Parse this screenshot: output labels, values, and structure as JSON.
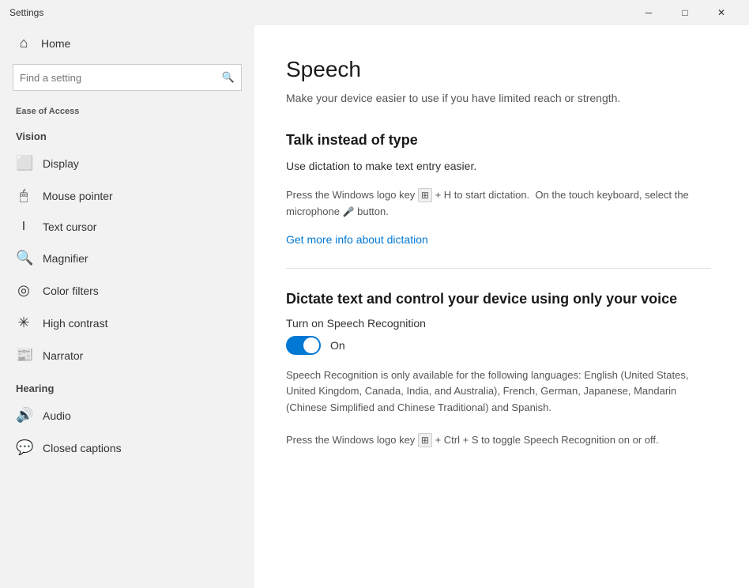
{
  "titleBar": {
    "title": "Settings",
    "minimizeLabel": "─",
    "maximizeLabel": "□",
    "closeLabel": "✕"
  },
  "sidebar": {
    "homeLabel": "Home",
    "searchPlaceholder": "Find a setting",
    "breadcrumb": "Ease of Access",
    "visionLabel": "Vision",
    "items": [
      {
        "id": "display",
        "label": "Display",
        "icon": "🖥"
      },
      {
        "id": "mouse-pointer",
        "label": "Mouse pointer",
        "icon": "🖱"
      },
      {
        "id": "text-cursor",
        "label": "Text cursor",
        "icon": "I"
      },
      {
        "id": "magnifier",
        "label": "Magnifier",
        "icon": "🔍"
      },
      {
        "id": "color-filters",
        "label": "Color filters",
        "icon": "🎨"
      },
      {
        "id": "high-contrast",
        "label": "High contrast",
        "icon": "☀"
      },
      {
        "id": "narrator",
        "label": "Narrator",
        "icon": "📰"
      }
    ],
    "hearingLabel": "Hearing",
    "hearingItems": [
      {
        "id": "audio",
        "label": "Audio",
        "icon": "🔊"
      },
      {
        "id": "closed-captions",
        "label": "Closed captions",
        "icon": "💬"
      }
    ]
  },
  "content": {
    "pageTitle": "Speech",
    "pageSubtitle": "Make your device easier to use if you have limited reach or strength.",
    "section1": {
      "heading": "Talk instead of type",
      "description": "Use dictation to make text entry easier.",
      "info": "Press the Windows logo key  + H to start dictation.  On the touch keyboard, select the microphone  button.",
      "linkText": "Get more info about dictation"
    },
    "section2": {
      "heading": "Dictate text and control your device using only your voice",
      "toggleLabel": "Turn on Speech Recognition",
      "toggleState": "On",
      "toggleOn": true,
      "recognitionInfo": "Speech Recognition is only available for the following languages: English (United States, United Kingdom, Canada, India, and Australia), French, German, Japanese, Mandarin (Chinese Simplified and Chinese Traditional) and Spanish.",
      "shortcutText": "Press the Windows logo key  + Ctrl + S to toggle Speech Recognition on or off."
    }
  }
}
